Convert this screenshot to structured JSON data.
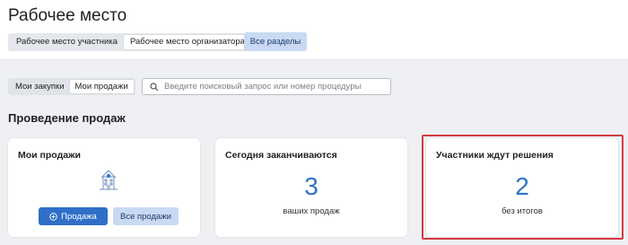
{
  "header": {
    "title": "Рабочее место",
    "tabs": [
      {
        "label": "Рабочее место участника",
        "active": false
      },
      {
        "label": "Рабочее место организатора",
        "active": true
      }
    ],
    "all_sections_label": "Все разделы"
  },
  "filters": {
    "tabs": [
      {
        "label": "Мои закупки",
        "active": false
      },
      {
        "label": "Мои продажи",
        "active": true
      }
    ],
    "search": {
      "placeholder": "Введите поисковый запрос или номер процедуры",
      "value": "",
      "icon": "search-icon"
    }
  },
  "section": {
    "title": "Проведение продаж",
    "cards": {
      "my_sales": {
        "title": "Мои продажи",
        "icon": "building-icon",
        "primary_button": {
          "label": "Продажа",
          "icon": "plus-circle-icon"
        },
        "secondary_button": {
          "label": "Все продажи"
        }
      },
      "ending_today": {
        "title": "Сегодня заканчиваются",
        "count": "3",
        "subtitle": "ваших продаж"
      },
      "awaiting_decision": {
        "title": "Участники ждут решения",
        "count": "2",
        "subtitle": "без итогов"
      }
    }
  },
  "colors": {
    "accent": "#2f6fc7",
    "number": "#2f73c4",
    "highlight": "#d43a3f"
  }
}
